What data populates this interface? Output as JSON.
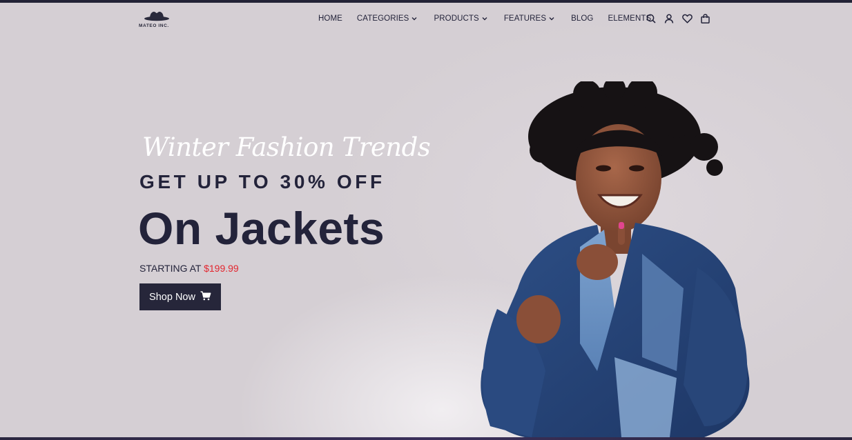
{
  "brand": {
    "logo_text": "MATEO INC."
  },
  "nav": {
    "items": [
      {
        "label": "HOME",
        "has_dropdown": false
      },
      {
        "label": "CATEGORIES",
        "has_dropdown": true
      },
      {
        "label": "PRODUCTS",
        "has_dropdown": true
      },
      {
        "label": "FEATURES",
        "has_dropdown": true
      },
      {
        "label": "BLOG",
        "has_dropdown": false
      },
      {
        "label": "ELEMENTS",
        "has_dropdown": false
      }
    ]
  },
  "header_icons": [
    "search-icon",
    "user-icon",
    "heart-icon",
    "shopping-bag-icon"
  ],
  "hero": {
    "script_title": "Winter Fashion Trends",
    "promo": "GET UP TO 30% OFF",
    "headline": "On Jackets",
    "price_prefix": "STARTING AT",
    "price": "$199.99",
    "cta_label": "Shop Now",
    "cta_icon": "cart-icon"
  },
  "colors": {
    "background": "#d5cfd4",
    "text_dark": "#23233a",
    "price_red": "#e3262f",
    "button_bg": "#26263a",
    "script_white": "#ffffff"
  }
}
